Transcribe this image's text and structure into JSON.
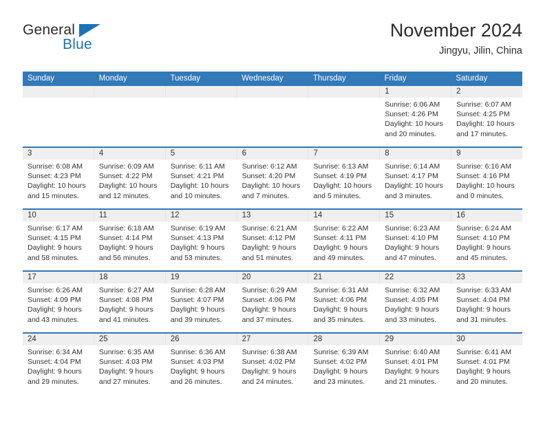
{
  "brand": {
    "name_part1": "General",
    "name_part2": "Blue",
    "accent_color": "#1b72b8"
  },
  "header": {
    "title": "November 2024",
    "location": "Jingyu, Jilin, China"
  },
  "calendar": {
    "header_bg": "#3279b8",
    "number_band_bg": "#efefef",
    "week_separator_color": "#2f76b5",
    "day_names": [
      "Sunday",
      "Monday",
      "Tuesday",
      "Wednesday",
      "Thursday",
      "Friday",
      "Saturday"
    ],
    "weeks": [
      [
        {
          "day": "",
          "lines": []
        },
        {
          "day": "",
          "lines": []
        },
        {
          "day": "",
          "lines": []
        },
        {
          "day": "",
          "lines": []
        },
        {
          "day": "",
          "lines": []
        },
        {
          "day": "1",
          "lines": [
            "Sunrise: 6:06 AM",
            "Sunset: 4:26 PM",
            "Daylight: 10 hours",
            "and 20 minutes."
          ]
        },
        {
          "day": "2",
          "lines": [
            "Sunrise: 6:07 AM",
            "Sunset: 4:25 PM",
            "Daylight: 10 hours",
            "and 17 minutes."
          ]
        }
      ],
      [
        {
          "day": "3",
          "lines": [
            "Sunrise: 6:08 AM",
            "Sunset: 4:23 PM",
            "Daylight: 10 hours",
            "and 15 minutes."
          ]
        },
        {
          "day": "4",
          "lines": [
            "Sunrise: 6:09 AM",
            "Sunset: 4:22 PM",
            "Daylight: 10 hours",
            "and 12 minutes."
          ]
        },
        {
          "day": "5",
          "lines": [
            "Sunrise: 6:11 AM",
            "Sunset: 4:21 PM",
            "Daylight: 10 hours",
            "and 10 minutes."
          ]
        },
        {
          "day": "6",
          "lines": [
            "Sunrise: 6:12 AM",
            "Sunset: 4:20 PM",
            "Daylight: 10 hours",
            "and 7 minutes."
          ]
        },
        {
          "day": "7",
          "lines": [
            "Sunrise: 6:13 AM",
            "Sunset: 4:19 PM",
            "Daylight: 10 hours",
            "and 5 minutes."
          ]
        },
        {
          "day": "8",
          "lines": [
            "Sunrise: 6:14 AM",
            "Sunset: 4:17 PM",
            "Daylight: 10 hours",
            "and 3 minutes."
          ]
        },
        {
          "day": "9",
          "lines": [
            "Sunrise: 6:16 AM",
            "Sunset: 4:16 PM",
            "Daylight: 10 hours",
            "and 0 minutes."
          ]
        }
      ],
      [
        {
          "day": "10",
          "lines": [
            "Sunrise: 6:17 AM",
            "Sunset: 4:15 PM",
            "Daylight: 9 hours",
            "and 58 minutes."
          ]
        },
        {
          "day": "11",
          "lines": [
            "Sunrise: 6:18 AM",
            "Sunset: 4:14 PM",
            "Daylight: 9 hours",
            "and 56 minutes."
          ]
        },
        {
          "day": "12",
          "lines": [
            "Sunrise: 6:19 AM",
            "Sunset: 4:13 PM",
            "Daylight: 9 hours",
            "and 53 minutes."
          ]
        },
        {
          "day": "13",
          "lines": [
            "Sunrise: 6:21 AM",
            "Sunset: 4:12 PM",
            "Daylight: 9 hours",
            "and 51 minutes."
          ]
        },
        {
          "day": "14",
          "lines": [
            "Sunrise: 6:22 AM",
            "Sunset: 4:11 PM",
            "Daylight: 9 hours",
            "and 49 minutes."
          ]
        },
        {
          "day": "15",
          "lines": [
            "Sunrise: 6:23 AM",
            "Sunset: 4:10 PM",
            "Daylight: 9 hours",
            "and 47 minutes."
          ]
        },
        {
          "day": "16",
          "lines": [
            "Sunrise: 6:24 AM",
            "Sunset: 4:10 PM",
            "Daylight: 9 hours",
            "and 45 minutes."
          ]
        }
      ],
      [
        {
          "day": "17",
          "lines": [
            "Sunrise: 6:26 AM",
            "Sunset: 4:09 PM",
            "Daylight: 9 hours",
            "and 43 minutes."
          ]
        },
        {
          "day": "18",
          "lines": [
            "Sunrise: 6:27 AM",
            "Sunset: 4:08 PM",
            "Daylight: 9 hours",
            "and 41 minutes."
          ]
        },
        {
          "day": "19",
          "lines": [
            "Sunrise: 6:28 AM",
            "Sunset: 4:07 PM",
            "Daylight: 9 hours",
            "and 39 minutes."
          ]
        },
        {
          "day": "20",
          "lines": [
            "Sunrise: 6:29 AM",
            "Sunset: 4:06 PM",
            "Daylight: 9 hours",
            "and 37 minutes."
          ]
        },
        {
          "day": "21",
          "lines": [
            "Sunrise: 6:31 AM",
            "Sunset: 4:06 PM",
            "Daylight: 9 hours",
            "and 35 minutes."
          ]
        },
        {
          "day": "22",
          "lines": [
            "Sunrise: 6:32 AM",
            "Sunset: 4:05 PM",
            "Daylight: 9 hours",
            "and 33 minutes."
          ]
        },
        {
          "day": "23",
          "lines": [
            "Sunrise: 6:33 AM",
            "Sunset: 4:04 PM",
            "Daylight: 9 hours",
            "and 31 minutes."
          ]
        }
      ],
      [
        {
          "day": "24",
          "lines": [
            "Sunrise: 6:34 AM",
            "Sunset: 4:04 PM",
            "Daylight: 9 hours",
            "and 29 minutes."
          ]
        },
        {
          "day": "25",
          "lines": [
            "Sunrise: 6:35 AM",
            "Sunset: 4:03 PM",
            "Daylight: 9 hours",
            "and 27 minutes."
          ]
        },
        {
          "day": "26",
          "lines": [
            "Sunrise: 6:36 AM",
            "Sunset: 4:03 PM",
            "Daylight: 9 hours",
            "and 26 minutes."
          ]
        },
        {
          "day": "27",
          "lines": [
            "Sunrise: 6:38 AM",
            "Sunset: 4:02 PM",
            "Daylight: 9 hours",
            "and 24 minutes."
          ]
        },
        {
          "day": "28",
          "lines": [
            "Sunrise: 6:39 AM",
            "Sunset: 4:02 PM",
            "Daylight: 9 hours",
            "and 23 minutes."
          ]
        },
        {
          "day": "29",
          "lines": [
            "Sunrise: 6:40 AM",
            "Sunset: 4:01 PM",
            "Daylight: 9 hours",
            "and 21 minutes."
          ]
        },
        {
          "day": "30",
          "lines": [
            "Sunrise: 6:41 AM",
            "Sunset: 4:01 PM",
            "Daylight: 9 hours",
            "and 20 minutes."
          ]
        }
      ]
    ]
  }
}
